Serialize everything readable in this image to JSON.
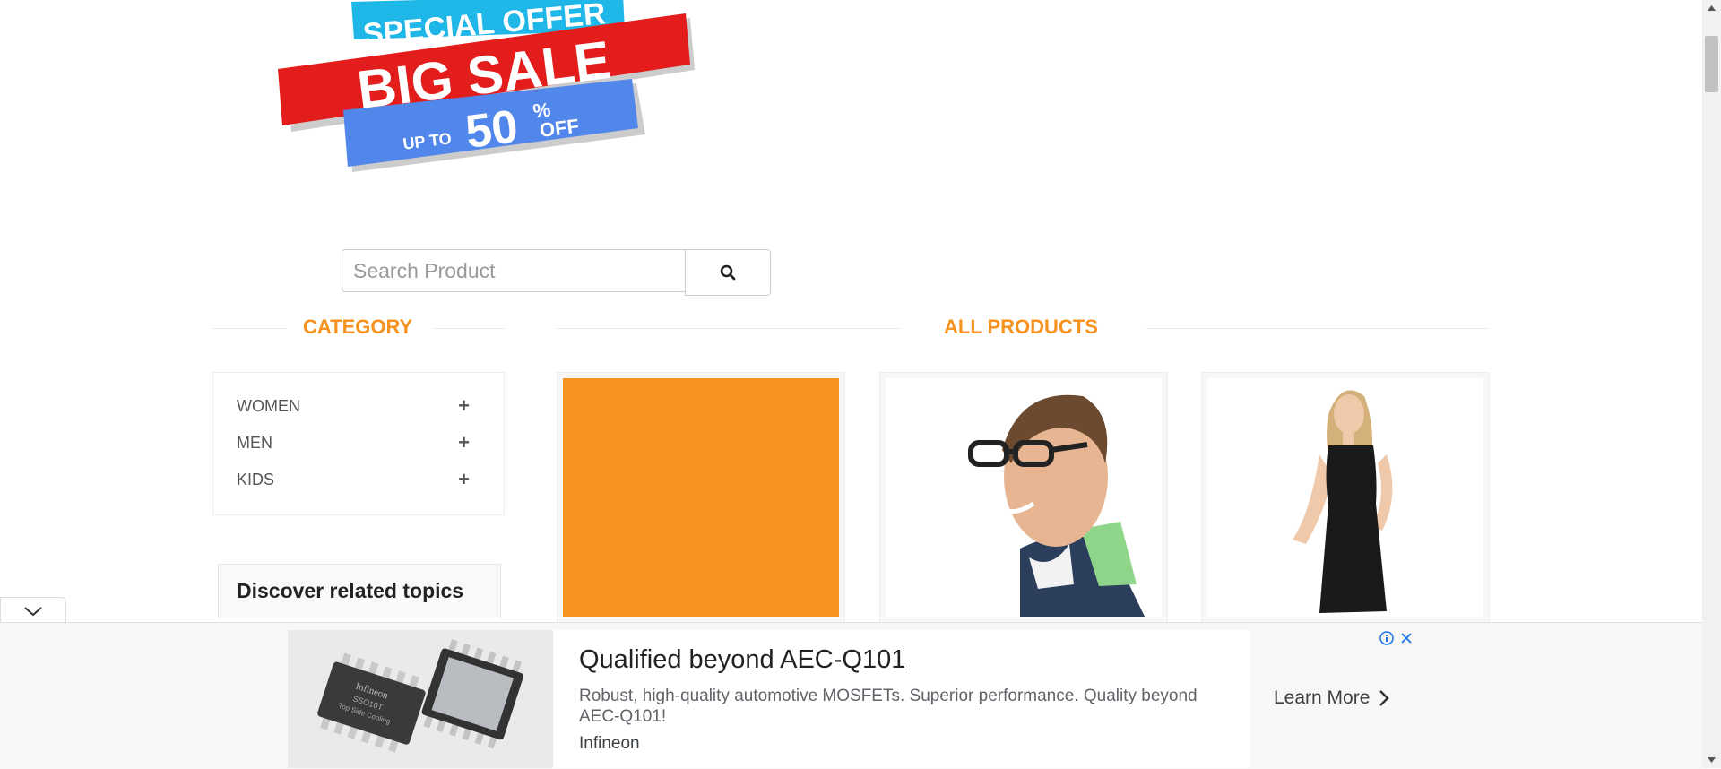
{
  "banner": {
    "line1": "SPECIAL OFFER",
    "line2": "BIG SALE",
    "up_to": "UP TO",
    "percent": "50",
    "percent_sign": "%",
    "off": "OFF"
  },
  "search": {
    "placeholder": "Search Product"
  },
  "category": {
    "title": "CATEGORY",
    "items": [
      {
        "label": "WOMEN"
      },
      {
        "label": "MEN"
      },
      {
        "label": "KIDS"
      }
    ]
  },
  "products": {
    "title": "ALL PRODUCTS"
  },
  "related": {
    "title": "Discover related topics"
  },
  "ad": {
    "title": "Qualified beyond AEC-Q101",
    "description": "Robust, high-quality automotive MOSFETs. Superior performance. Quality beyond AEC-Q101!",
    "brand": "Infineon",
    "cta": "Learn More",
    "chip1_brand": "Infineon",
    "chip1_code": "SSO10T",
    "chip1_sub": "Top Side Cooling"
  },
  "colors": {
    "accent": "#F7931E",
    "product_placeholder": "#F7931E"
  }
}
